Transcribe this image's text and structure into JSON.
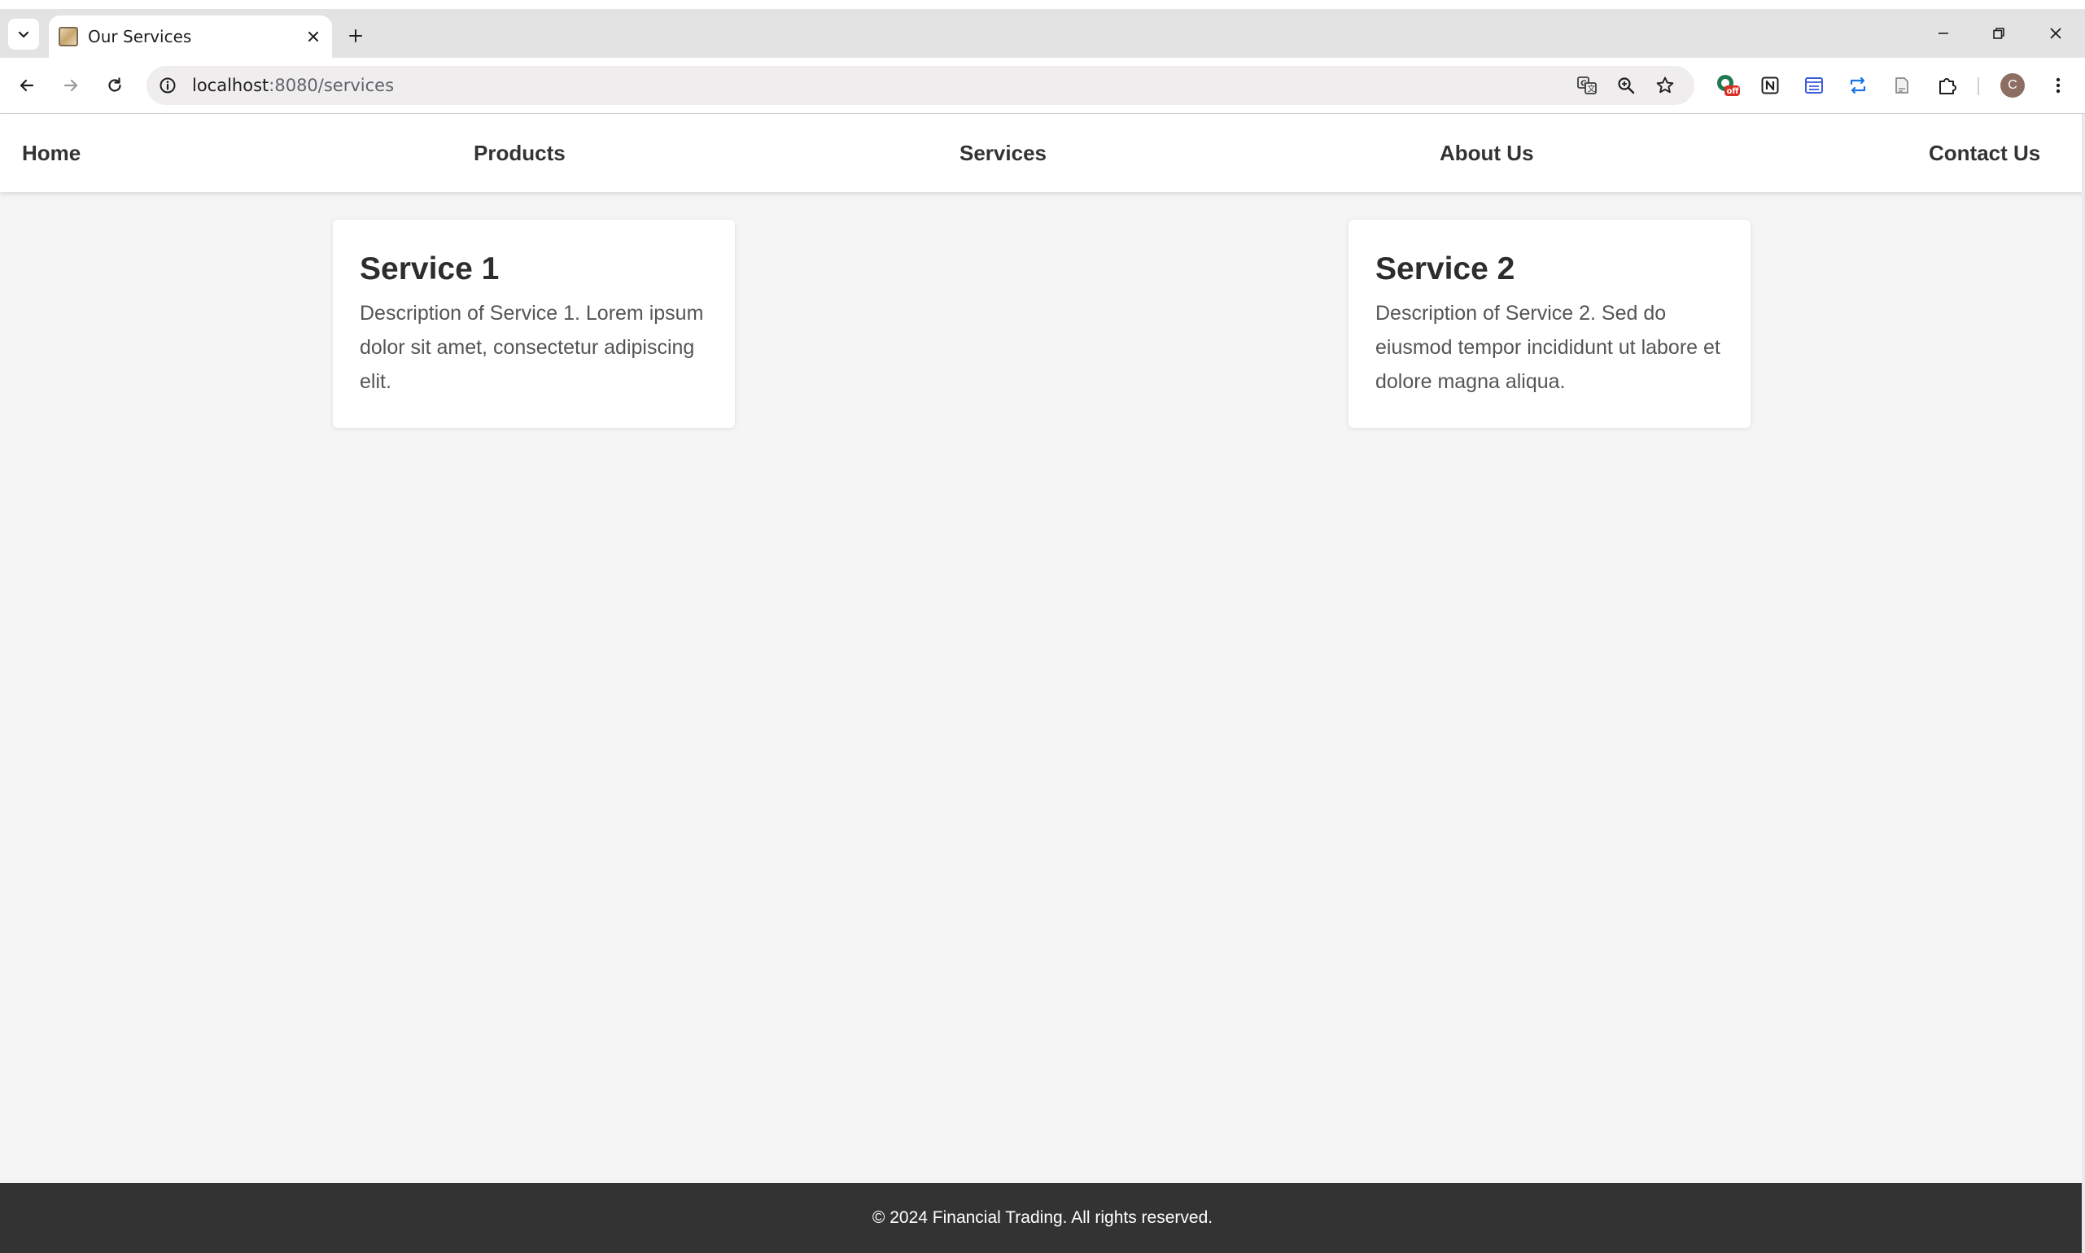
{
  "browser": {
    "tab_title": "Our Services",
    "url_host": "localhost",
    "url_path": ":8080/services",
    "avatar_letter": "C",
    "extension_badge": "off"
  },
  "nav": {
    "items": [
      {
        "label": "Home"
      },
      {
        "label": "Products"
      },
      {
        "label": "Services"
      },
      {
        "label": "About Us"
      },
      {
        "label": "Contact Us"
      }
    ]
  },
  "services": [
    {
      "title": "Service 1",
      "description": "Description of Service 1. Lorem ipsum dolor sit amet, consectetur adipiscing elit."
    },
    {
      "title": "Service 2",
      "description": "Description of Service 2. Sed do eiusmod tempor incididunt ut labore et dolore magna aliqua."
    }
  ],
  "footer": {
    "text": "© 2024 Financial Trading. All rights reserved."
  },
  "colors": {
    "page_background": "#f5f5f5",
    "footer_background": "#333333",
    "nav_text": "#333333"
  }
}
